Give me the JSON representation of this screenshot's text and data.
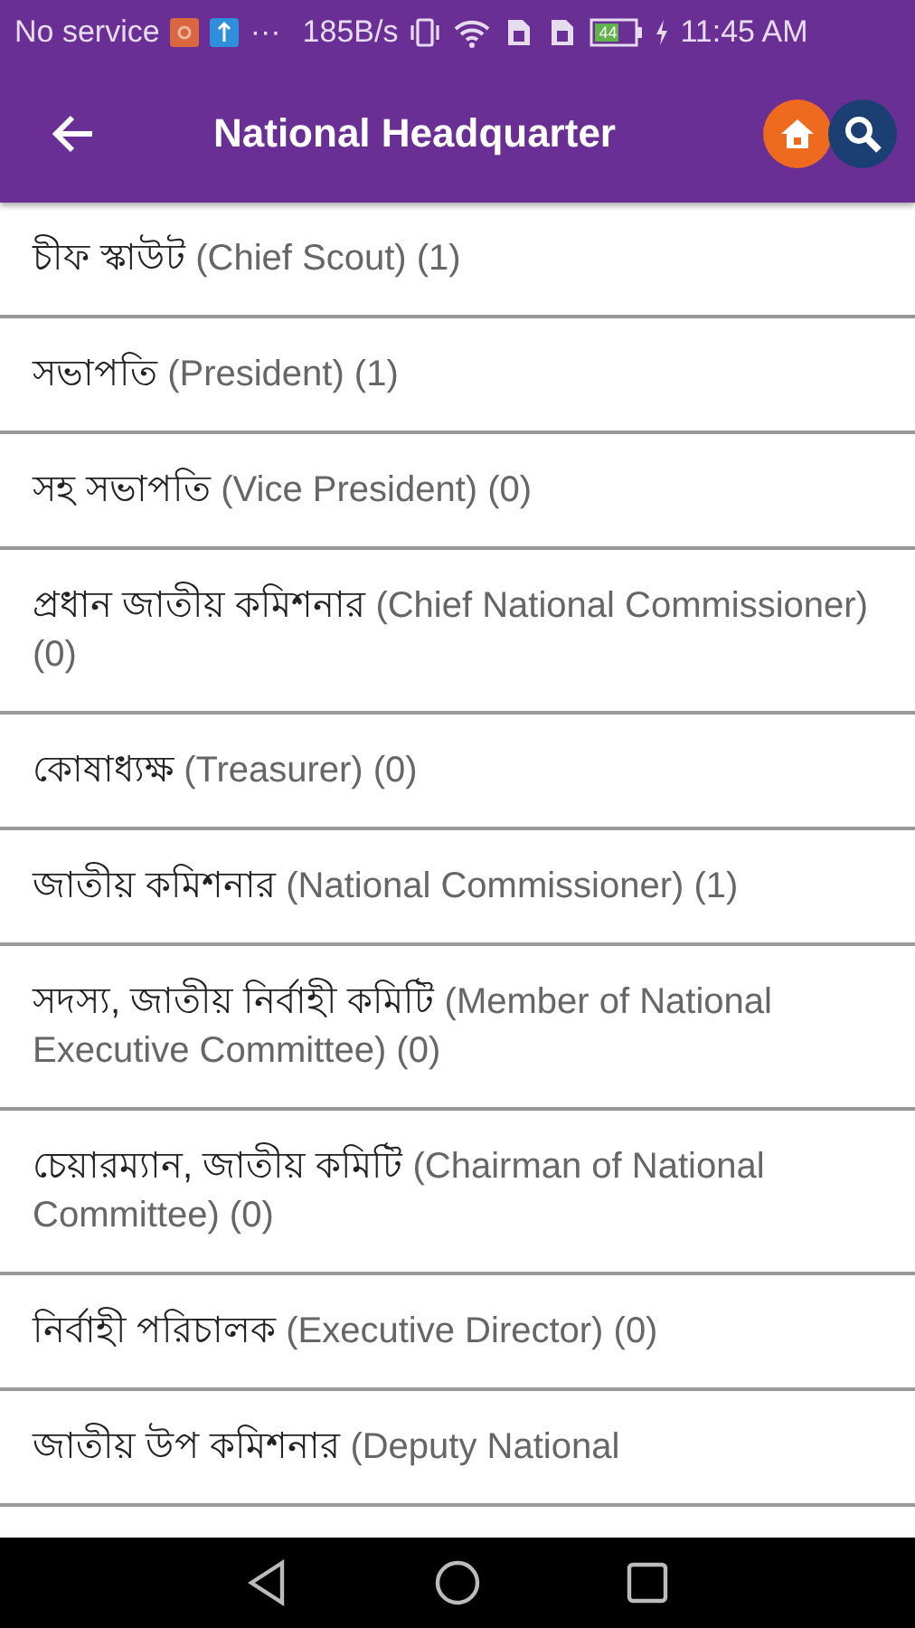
{
  "status_bar": {
    "carrier": "No service",
    "more": "···",
    "speed": "185B/s",
    "battery": "44",
    "time": "11:45 AM"
  },
  "app_bar": {
    "title": "National Headquarter"
  },
  "items": [
    {
      "bengali": "চীফ স্কাউট",
      "english": "(Chief Scout) (1)"
    },
    {
      "bengali": "সভাপতি",
      "english": "(President) (1)"
    },
    {
      "bengali": "সহ সভাপতি",
      "english": "(Vice President) (0)"
    },
    {
      "bengali": "প্রধান জাতীয় কমিশনার",
      "english": "(Chief National Commissioner) (0)"
    },
    {
      "bengali": "কোষাধ্যক্ষ",
      "english": "(Treasurer) (0)"
    },
    {
      "bengali": "জাতীয় কমিশনার",
      "english": "(National Commissioner) (1)"
    },
    {
      "bengali": "সদস্য, জাতীয় নির্বাহী কমিটি",
      "english": "(Member of National Executive Committee) (0)"
    },
    {
      "bengali": "চেয়ারম্যান, জাতীয় কমিটি",
      "english": "(Chairman of National Committee) (0)"
    },
    {
      "bengali": "নির্বাহী পরিচালক",
      "english": "(Executive Director) (0)"
    },
    {
      "bengali": "জাতীয় উপ কমিশনার",
      "english": "(Deputy National"
    }
  ]
}
